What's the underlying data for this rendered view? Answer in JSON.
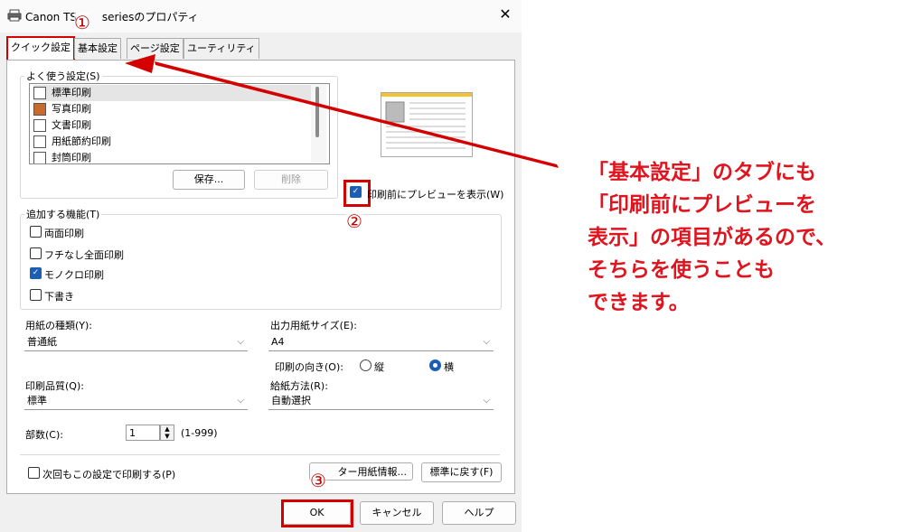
{
  "window": {
    "title": "Canon TS　　 seriesのプロパティ",
    "close_label": "✕"
  },
  "tabs": [
    "クイック設定",
    "基本設定",
    "ページ設定",
    "ユーティリティ"
  ],
  "favorites": {
    "group_label": "よく使う設定(S)",
    "items": [
      "標準印刷",
      "写真印刷",
      "文書印刷",
      "用紙節約印刷",
      "封筒印刷"
    ],
    "selected_index": 0,
    "save_label": "保存...",
    "delete_label": "削除"
  },
  "preview_checkbox": {
    "label": "印刷前にプレビューを表示(W)",
    "checked": true
  },
  "features": {
    "group_label": "追加する機能(T)",
    "items": [
      {
        "label": "両面印刷",
        "checked": false
      },
      {
        "label": "フチなし全面印刷",
        "checked": false
      },
      {
        "label": "モノクロ印刷",
        "checked": true
      },
      {
        "label": "下書き",
        "checked": false
      }
    ]
  },
  "media_type": {
    "label": "用紙の種類(Y):",
    "value": "普通紙"
  },
  "output_size": {
    "label": "出力用紙サイズ(E):",
    "value": "A4"
  },
  "orientation": {
    "label": "印刷の向き(O):",
    "portrait": "縦",
    "landscape": "横",
    "selected": "横"
  },
  "quality": {
    "label": "印刷品質(Q):",
    "value": "標準"
  },
  "paper_source": {
    "label": "給紙方法(R):",
    "value": "自動選択"
  },
  "copies": {
    "label": "部数(C):",
    "value": "1",
    "range": "(1-999)"
  },
  "always_print_checkbox": {
    "label": "次回もこの設定で印刷する(P)",
    "checked": false
  },
  "printer_paper_info_label": "ター用紙情報...",
  "defaults_label": "標準に戻す(F)",
  "footer": {
    "ok": "OK",
    "cancel": "キャンセル",
    "help": "ヘルプ"
  },
  "markers": [
    "①",
    "②",
    "③"
  ],
  "annotation_lines": [
    "「基本設定」のタブにも",
    "「印刷前にプレビューを",
    "表示」の項目があるので、",
    "そちらを使うことも",
    "できます。"
  ],
  "colors": {
    "annotation_red": "#e0141e",
    "highlight_red": "#d40000",
    "accent_blue": "#1a5fb4"
  }
}
